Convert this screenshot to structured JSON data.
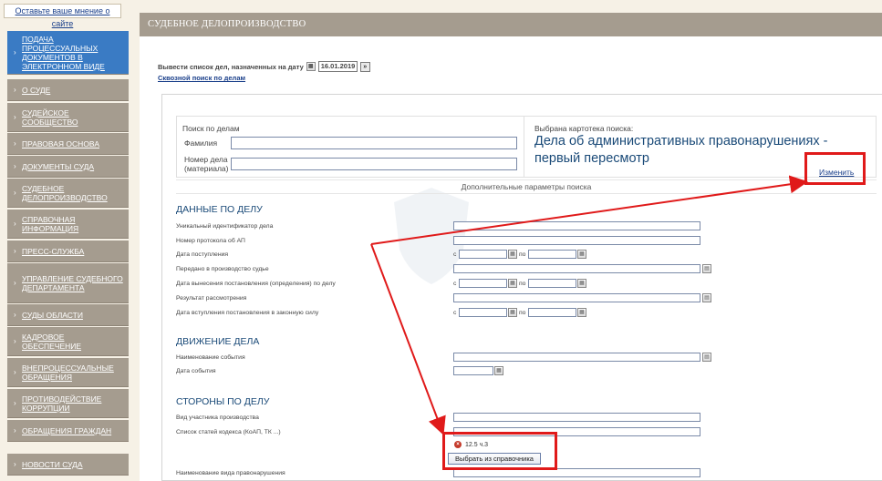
{
  "sidebar": {
    "feedback_link": "Оставьте ваше мнение о сайте",
    "items": [
      {
        "label": "ПОДАЧА ПРОЦЕССУАЛЬНЫХ ДОКУМЕНТОВ В ЭЛЕКТРОННОМ ВИДЕ",
        "active": true
      },
      {
        "label": "О СУДЕ"
      },
      {
        "label": "СУДЕЙСКОЕ СООБЩЕСТВО"
      },
      {
        "label": "ПРАВОВАЯ ОСНОВА"
      },
      {
        "label": "ДОКУМЕНТЫ СУДА"
      },
      {
        "label": "СУДЕБНОЕ ДЕЛОПРОИЗВОДСТВО"
      },
      {
        "label": "СПРАВОЧНАЯ ИНФОРМАЦИЯ"
      },
      {
        "label": "ПРЕСС-СЛУЖБА"
      },
      {
        "label": "УПРАВЛЕНИЕ СУДЕБНОГО ДЕПАРТАМЕНТА"
      },
      {
        "label": "СУДЫ ОБЛАСТИ"
      },
      {
        "label": "КАДРОВОЕ ОБЕСПЕЧЕНИЕ"
      },
      {
        "label": "ВНЕПРОЦЕССУАЛЬНЫЕ ОБРАЩЕНИЯ"
      },
      {
        "label": "ПРОТИВОДЕЙСТВИЕ КОРРУПЦИИ"
      },
      {
        "label": "ОБРАЩЕНИЯ ГРАЖДАН"
      },
      {
        "label": "НОВОСТИ СУДА"
      }
    ],
    "chevron": "›"
  },
  "header": {
    "title": "СУДЕБНОЕ ДЕЛОПРОИЗВОДСТВО"
  },
  "date_filter": {
    "label": "Вывести список дел, назначенных на дату",
    "date": "16.01.2019",
    "cross_search": "Сквозной поиск по делам"
  },
  "search": {
    "title": "Поиск по делам",
    "surname_label": "Фамилия",
    "case_no_label_1": "Номер дела",
    "case_no_label_2": "(материала)",
    "catalog_label": "Выбрана картотека поиска:",
    "catalog_name": "Дела об административных правонарушениях - первый пересмотр",
    "change_link": "Изменить",
    "extra_params": "Дополнительные параметры поиска"
  },
  "case_data": {
    "title": "ДАННЫЕ ПО ДЕЛУ",
    "fields": [
      "Уникальный идентификатор дела",
      "Номер протокола об АП",
      "Дата поступления",
      "Передано в производство судье",
      "Дата вынесения постановления (определения) по делу",
      "Результат рассмотрения",
      "Дата вступления постановления в законную силу"
    ],
    "from": "с",
    "to": "по"
  },
  "movement": {
    "title": "ДВИЖЕНИЕ ДЕЛА",
    "fields": [
      "Наименование события",
      "Дата события"
    ]
  },
  "parties": {
    "title": "СТОРОНЫ ПО ДЕЛУ",
    "fields": [
      "Вид участника производства",
      "Список статей кодекса (КоАП, ТК ...)",
      "Наименование вида правонарушения"
    ],
    "selected_article": "12.5 ч.3",
    "pick_button": "Выбрать из справочника"
  },
  "icons": {
    "calendar": "calendar-icon",
    "go": "arrow-right-icon",
    "remove": "remove-icon"
  },
  "colors": {
    "nav_bg": "#a59c8f",
    "nav_active": "#3a7bc4",
    "heading": "#1a4a78",
    "annotation": "#e01a1a"
  }
}
